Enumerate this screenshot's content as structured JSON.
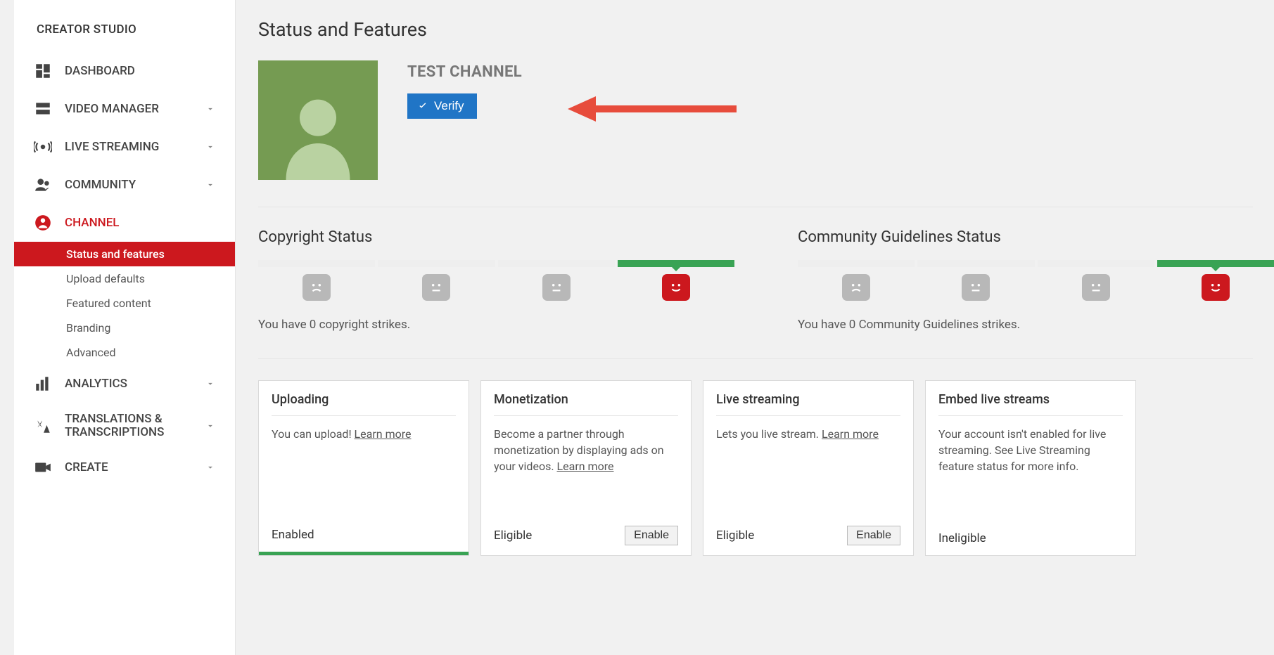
{
  "sidebar": {
    "title": "CREATOR STUDIO",
    "items": [
      {
        "label": "DASHBOARD"
      },
      {
        "label": "VIDEO MANAGER"
      },
      {
        "label": "LIVE STREAMING"
      },
      {
        "label": "COMMUNITY"
      },
      {
        "label": "CHANNEL"
      },
      {
        "label": "ANALYTICS"
      },
      {
        "label": "TRANSLATIONS & TRANSCRIPTIONS"
      },
      {
        "label": "CREATE"
      }
    ],
    "channel_sub": [
      {
        "label": "Status and features"
      },
      {
        "label": "Upload defaults"
      },
      {
        "label": "Featured content"
      },
      {
        "label": "Branding"
      },
      {
        "label": "Advanced"
      }
    ]
  },
  "page": {
    "title": "Status and Features",
    "channel_name": "TEST CHANNEL",
    "verify_label": "Verify"
  },
  "statuses": {
    "copyright": {
      "title": "Copyright Status",
      "text": "You have 0 copyright strikes."
    },
    "community": {
      "title": "Community Guidelines Status",
      "text": "You have 0 Community Guidelines strikes."
    }
  },
  "features": [
    {
      "title": "Uploading",
      "desc_pre": "You can upload! ",
      "learn_more": "Learn more",
      "footer_status": "Enabled",
      "enable_btn": false,
      "enabled_bar": true
    },
    {
      "title": "Monetization",
      "desc_pre": "Become a partner through monetization by displaying ads on your videos. ",
      "learn_more": "Learn more",
      "footer_status": "Eligible",
      "enable_btn": true,
      "enable_label": "Enable"
    },
    {
      "title": "Live streaming",
      "desc_pre": "Lets you live stream. ",
      "learn_more": "Learn more",
      "footer_status": "Eligible",
      "enable_btn": true,
      "enable_label": "Enable"
    },
    {
      "title": "Embed live streams",
      "desc_pre": "Your account isn't enabled for live streaming. See Live Streaming feature status for more info.",
      "learn_more": "",
      "footer_status": "Ineligible",
      "enable_btn": false
    }
  ]
}
